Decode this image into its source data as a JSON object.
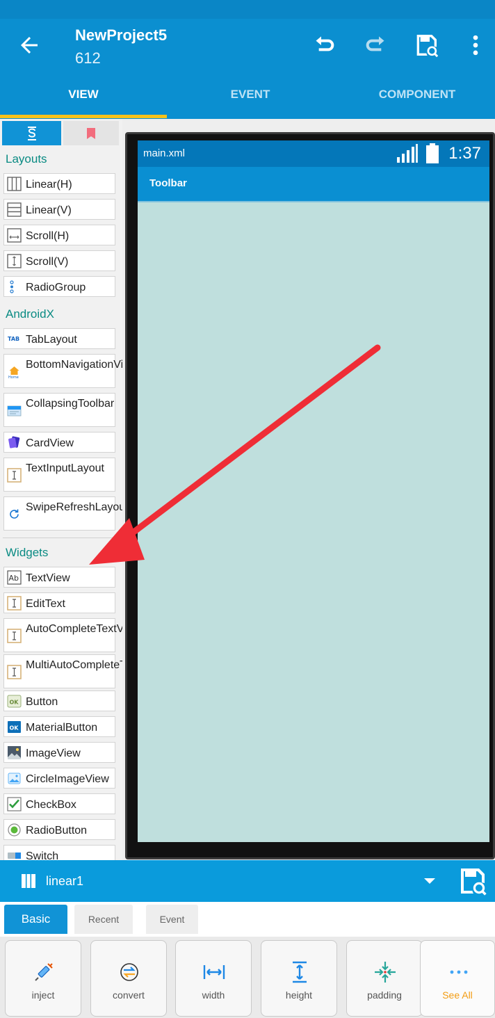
{
  "app": {
    "title": "NewProject5",
    "subtitle": "612",
    "tabs": [
      "VIEW",
      "EVENT",
      "COMPONENT"
    ],
    "active_tab": "VIEW",
    "colors": {
      "primary": "#0b8fd0",
      "accent": "#f6c21b",
      "section": "#0a8b83",
      "arrow": "#ef2d36"
    }
  },
  "toolbar_icons": [
    "back-arrow-icon",
    "undo-icon",
    "redo-icon",
    "save-icon",
    "more-vert-icon"
  ],
  "palette": {
    "tabs": [
      "widgets-tab-icon",
      "bookmark-icon"
    ],
    "sections": {
      "layouts": {
        "header": "Layouts",
        "items": [
          "Linear(H)",
          "Linear(V)",
          "Scroll(H)",
          "Scroll(V)",
          "RadioGroup"
        ]
      },
      "androidx": {
        "header": "AndroidX",
        "items": [
          "TabLayout",
          "BottomNavigationView",
          "CollapsingToolbar",
          "CardView",
          "TextInputLayout",
          "SwipeRefreshLayout"
        ]
      },
      "widgets": {
        "header": "Widgets",
        "items": [
          "TextView",
          "EditText",
          "AutoCompleteTextView",
          "MultiAutoCompleteTextView",
          "Button",
          "MaterialButton",
          "ImageView",
          "CircleImageView",
          "CheckBox",
          "RadioButton",
          "Switch"
        ]
      }
    }
  },
  "preview": {
    "file": "main.xml",
    "time": "1:37",
    "toolbar": "Toolbar",
    "content_color": "#bfdfdd"
  },
  "selected": {
    "name": "linear1"
  },
  "property_tabs": [
    "Basic",
    "Recent",
    "Event"
  ],
  "active_property_tab": "Basic",
  "actions": [
    {
      "label": "inject",
      "icon": "syringe-icon"
    },
    {
      "label": "convert",
      "icon": "convert-icon"
    },
    {
      "label": "width",
      "icon": "width-icon"
    },
    {
      "label": "height",
      "icon": "height-icon"
    },
    {
      "label": "padding",
      "icon": "padding-icon"
    },
    {
      "label": "See All",
      "icon": "more-horiz-icon"
    }
  ]
}
